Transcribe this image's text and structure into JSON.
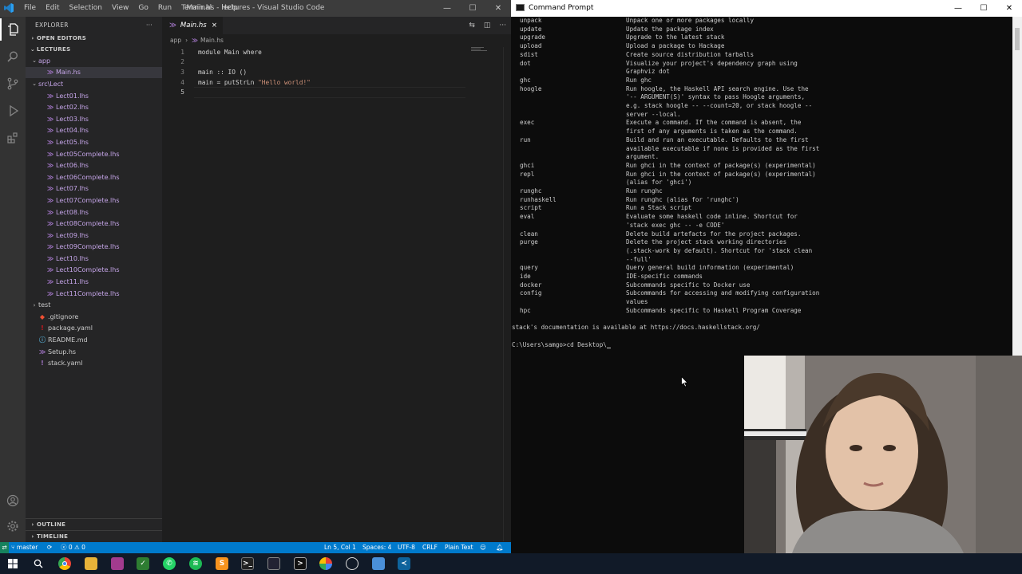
{
  "vscode": {
    "menu": [
      "File",
      "Edit",
      "Selection",
      "View",
      "Go",
      "Run",
      "Terminal",
      "Help"
    ],
    "window_title": "Main.hs - lectures - Visual Studio Code",
    "sidebar": {
      "header": "EXPLORER",
      "open_editors": "OPEN EDITORS",
      "project": "LECTURES",
      "tree": [
        {
          "label": "app",
          "type": "folder",
          "open": true
        },
        {
          "label": "Main.hs",
          "type": "file",
          "selected": true
        },
        {
          "label": "src\\Lect",
          "type": "folder",
          "open": true
        },
        {
          "label": "Lect01.lhs",
          "type": "lhs"
        },
        {
          "label": "Lect02.lhs",
          "type": "lhs"
        },
        {
          "label": "Lect03.lhs",
          "type": "lhs"
        },
        {
          "label": "Lect04.lhs",
          "type": "lhs"
        },
        {
          "label": "Lect05.lhs",
          "type": "lhs"
        },
        {
          "label": "Lect05Complete.lhs",
          "type": "lhs"
        },
        {
          "label": "Lect06.lhs",
          "type": "lhs"
        },
        {
          "label": "Lect06Complete.lhs",
          "type": "lhs"
        },
        {
          "label": "Lect07.lhs",
          "type": "lhs"
        },
        {
          "label": "Lect07Complete.lhs",
          "type": "lhs"
        },
        {
          "label": "Lect08.lhs",
          "type": "lhs"
        },
        {
          "label": "Lect08Complete.lhs",
          "type": "lhs"
        },
        {
          "label": "Lect09.lhs",
          "type": "lhs"
        },
        {
          "label": "Lect09Complete.lhs",
          "type": "lhs"
        },
        {
          "label": "Lect10.lhs",
          "type": "lhs"
        },
        {
          "label": "Lect10Complete.lhs",
          "type": "lhs"
        },
        {
          "label": "Lect11.lhs",
          "type": "lhs"
        },
        {
          "label": "Lect11Complete.lhs",
          "type": "lhs"
        },
        {
          "label": "test",
          "type": "folder",
          "open": false
        },
        {
          "label": ".gitignore",
          "type": "gitignore"
        },
        {
          "label": "package.yaml",
          "type": "yaml"
        },
        {
          "label": "README.md",
          "type": "md"
        },
        {
          "label": "Setup.hs",
          "type": "hs"
        },
        {
          "label": "stack.yaml",
          "type": "yaml-excl"
        }
      ],
      "outline": "OUTLINE",
      "timeline": "TIMELINE"
    },
    "tab": {
      "label": "Main.hs",
      "close": "×"
    },
    "breadcrumb": {
      "folder": "app",
      "file": "Main.hs"
    },
    "code_lines": [
      {
        "n": "1",
        "text": "module Main where"
      },
      {
        "n": "2",
        "text": ""
      },
      {
        "n": "3",
        "text": "main :: IO ()"
      },
      {
        "n": "4",
        "pre": "main = putStrLn ",
        "str": "\"Hello world!\""
      },
      {
        "n": "5",
        "text": ""
      }
    ],
    "status": {
      "branch": "master",
      "errors": "0",
      "warnings": "0",
      "position": "Ln 5, Col 1",
      "spaces": "Spaces: 4",
      "encoding": "UTF-8",
      "eol": "CRLF",
      "language": "Plain Text"
    },
    "colors": {
      "accent": "#007acc",
      "lhs": "#a074c4"
    }
  },
  "cmd": {
    "title": "Command Prompt",
    "rows": [
      [
        "unpack",
        "Unpack one or more packages locally"
      ],
      [
        "update",
        "Update the package index"
      ],
      [
        "upgrade",
        "Upgrade to the latest stack"
      ],
      [
        "upload",
        "Upload a package to Hackage"
      ],
      [
        "sdist",
        "Create source distribution tarballs"
      ],
      [
        "dot",
        "Visualize your project's dependency graph using"
      ],
      [
        "",
        "Graphviz dot"
      ],
      [
        "ghc",
        "Run ghc"
      ],
      [
        "hoogle",
        "Run hoogle, the Haskell API search engine. Use the"
      ],
      [
        "",
        "'-- ARGUMENT(S)' syntax to pass Hoogle arguments,"
      ],
      [
        "",
        "e.g. stack hoogle -- --count=20, or stack hoogle --"
      ],
      [
        "",
        "server --local."
      ],
      [
        "exec",
        "Execute a command. If the command is absent, the"
      ],
      [
        "",
        "first of any arguments is taken as the command."
      ],
      [
        "run",
        "Build and run an executable. Defaults to the first"
      ],
      [
        "",
        "available executable if none is provided as the first"
      ],
      [
        "",
        "argument."
      ],
      [
        "ghci",
        "Run ghci in the context of package(s) (experimental)"
      ],
      [
        "repl",
        "Run ghci in the context of package(s) (experimental)"
      ],
      [
        "",
        "(alias for 'ghci')"
      ],
      [
        "runghc",
        "Run runghc"
      ],
      [
        "runhaskell",
        "Run runghc (alias for 'runghc')"
      ],
      [
        "script",
        "Run a Stack script"
      ],
      [
        "eval",
        "Evaluate some haskell code inline. Shortcut for"
      ],
      [
        "",
        "'stack exec ghc -- -e CODE'"
      ],
      [
        "clean",
        "Delete build artefacts for the project packages."
      ],
      [
        "purge",
        "Delete the project stack working directories"
      ],
      [
        "",
        "(.stack-work by default). Shortcut for 'stack clean"
      ],
      [
        "",
        "--full'"
      ],
      [
        "query",
        "Query general build information (experimental)"
      ],
      [
        "ide",
        "IDE-specific commands"
      ],
      [
        "docker",
        "Subcommands specific to Docker use"
      ],
      [
        "config",
        "Subcommands for accessing and modifying configuration"
      ],
      [
        "",
        "values"
      ],
      [
        "hpc",
        "Subcommands specific to Haskell Program Coverage"
      ]
    ],
    "doc_line": "stack's documentation is available at https://docs.haskellstack.org/",
    "prompt": "C:\\Users\\samgo>cd Desktop\\"
  }
}
